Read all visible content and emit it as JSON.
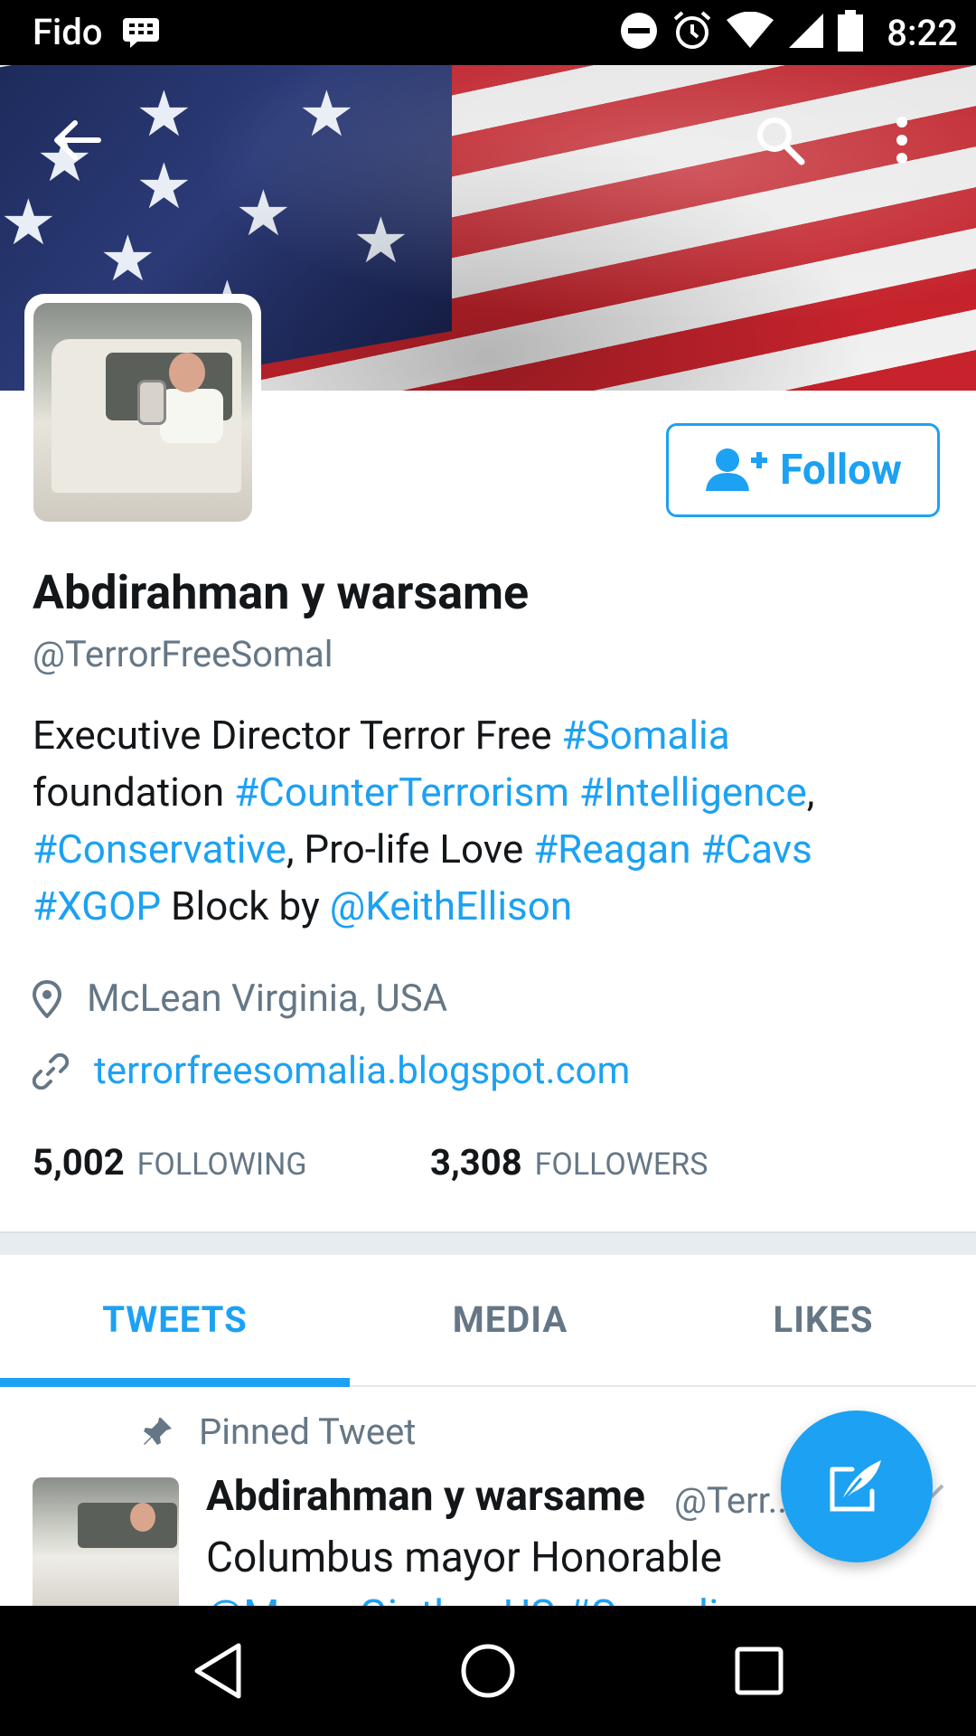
{
  "status_bar": {
    "carrier": "Fido",
    "time": "8:22",
    "icons": [
      "bbm-icon",
      "dnd-icon",
      "alarm-icon",
      "wifi-icon",
      "signal-icon",
      "battery-icon"
    ]
  },
  "header": {
    "back_icon": "back-arrow-icon",
    "search_icon": "search-icon",
    "menu_icon": "overflow-menu-icon"
  },
  "profile": {
    "follow_label": "Follow",
    "name": "Abdirahman y warsame",
    "handle": "@TerrorFreeSomal",
    "bio": {
      "segments": [
        {
          "text": "Executive Director Terror Free ",
          "link": false
        },
        {
          "text": "#Somalia",
          "link": true
        },
        {
          "text": " foundation  ",
          "link": false
        },
        {
          "text": "#CounterTerrorism",
          "link": true
        },
        {
          "text": " ",
          "link": false
        },
        {
          "text": "#Intelligence",
          "link": true
        },
        {
          "text": ", ",
          "link": false
        },
        {
          "text": "#Conservative",
          "link": true
        },
        {
          "text": ", Pro-life Love ",
          "link": false
        },
        {
          "text": "#Reagan",
          "link": true
        },
        {
          "text": " ",
          "link": false
        },
        {
          "text": "#Cavs",
          "link": true
        },
        {
          "text": " ",
          "link": false
        },
        {
          "text": "#XGOP",
          "link": true
        },
        {
          "text": " Block by ",
          "link": false
        },
        {
          "text": "@KeithEllison",
          "link": true
        }
      ]
    },
    "location": "McLean Virginia, USA",
    "url": "terrorfreesomalia.blogspot.com",
    "following_count": "5,002",
    "following_label": "FOLLOWING",
    "followers_count": "3,308",
    "followers_label": "FOLLOWERS"
  },
  "tabs": [
    {
      "label": "TWEETS",
      "active": true
    },
    {
      "label": "MEDIA",
      "active": false
    },
    {
      "label": "LIKES",
      "active": false
    }
  ],
  "pinned_tweet": {
    "pinned_label": "Pinned Tweet",
    "author_name": "Abdirahman y warsame",
    "author_handle": "@Terr...",
    "text_line1": "Columbus mayor Honorable",
    "text_line2": "@MayorGinther  US  #Somali"
  },
  "colors": {
    "accent": "#1da1f2",
    "secondary_text": "#657786",
    "primary_text": "#14171a"
  }
}
